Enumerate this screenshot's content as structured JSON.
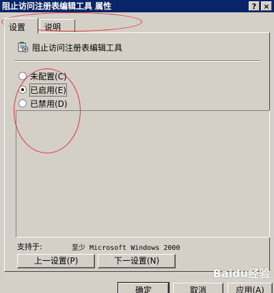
{
  "window": {
    "title": "阻止访问注册表编辑工具 属性",
    "help_button": "?",
    "close_button": "×"
  },
  "tabs": [
    {
      "label": "设置",
      "active": true
    },
    {
      "label": "说明",
      "active": false
    }
  ],
  "policy": {
    "name": "阻止访问注册表编辑工具"
  },
  "options": [
    {
      "label": "未配置(C)",
      "checked": false
    },
    {
      "label": "已启用(E)",
      "checked": true
    },
    {
      "label": "已禁用(D)",
      "checked": false
    }
  ],
  "supported": {
    "label": "支持于:",
    "value": "至少 Microsoft Windows 2000"
  },
  "nav": {
    "prev_label": "上一设置(P)",
    "next_label": "下一设置(N)"
  },
  "footer": {
    "ok_label": "确定",
    "cancel_label": "取消",
    "apply_label": "应用(A)"
  },
  "watermark": "Baidu经验",
  "colors": {
    "titlebar": "#0a246a",
    "face": "#d4d0c8",
    "annotation": "#e0303a"
  }
}
